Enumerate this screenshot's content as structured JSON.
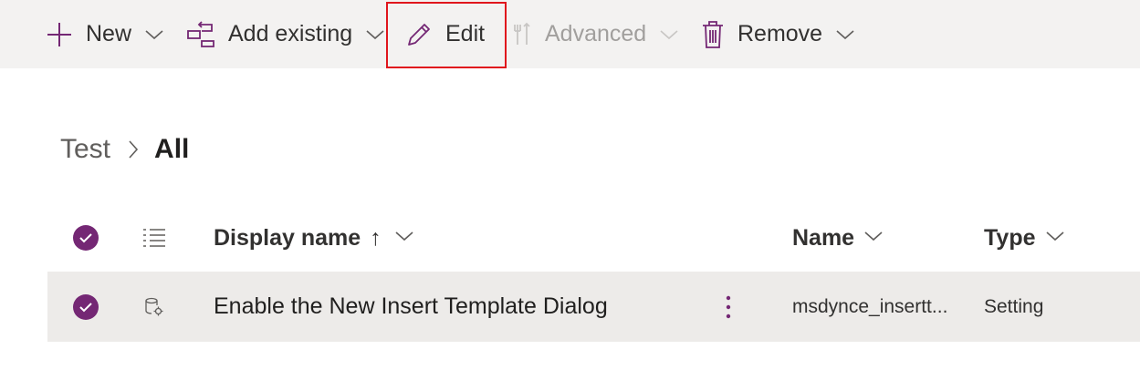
{
  "toolbar": {
    "new_label": "New",
    "add_existing_label": "Add existing",
    "edit_label": "Edit",
    "advanced_label": "Advanced",
    "remove_label": "Remove"
  },
  "breadcrumb": {
    "parent": "Test",
    "current": "All"
  },
  "grid": {
    "columns": {
      "display_name": "Display name",
      "sort_indicator": "↑",
      "name": "Name",
      "type": "Type"
    },
    "rows": [
      {
        "display_name": "Enable the New Insert Template Dialog",
        "name": "msdynce_insertt...",
        "type": "Setting",
        "selected": true
      }
    ]
  },
  "colors": {
    "accent": "#742774",
    "toolbar_bg": "#f3f2f1",
    "row_selected_bg": "#edebe9",
    "highlight_border": "#e0161d"
  },
  "icons": {
    "new": "plus-icon",
    "add_existing": "add-existing-icon",
    "edit": "pencil-icon",
    "advanced": "wrench-icon",
    "remove": "trash-icon",
    "row_type": "setting-icon"
  }
}
